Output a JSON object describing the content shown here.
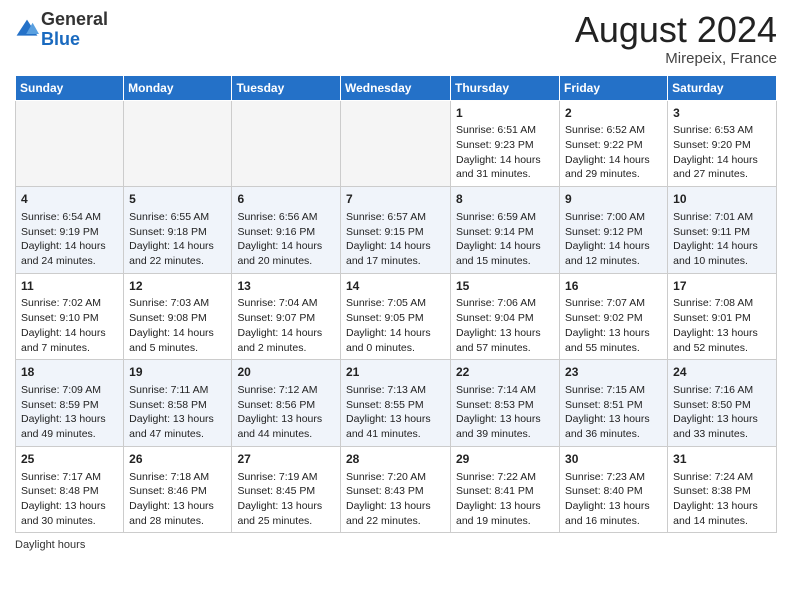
{
  "header": {
    "logo_general": "General",
    "logo_blue": "Blue",
    "month_year": "August 2024",
    "location": "Mirepeix, France"
  },
  "footer": {
    "daylight_label": "Daylight hours"
  },
  "days_of_week": [
    "Sunday",
    "Monday",
    "Tuesday",
    "Wednesday",
    "Thursday",
    "Friday",
    "Saturday"
  ],
  "weeks": [
    [
      {
        "day": "",
        "info": ""
      },
      {
        "day": "",
        "info": ""
      },
      {
        "day": "",
        "info": ""
      },
      {
        "day": "",
        "info": ""
      },
      {
        "day": "1",
        "info": "Sunrise: 6:51 AM\nSunset: 9:23 PM\nDaylight: 14 hours\nand 31 minutes."
      },
      {
        "day": "2",
        "info": "Sunrise: 6:52 AM\nSunset: 9:22 PM\nDaylight: 14 hours\nand 29 minutes."
      },
      {
        "day": "3",
        "info": "Sunrise: 6:53 AM\nSunset: 9:20 PM\nDaylight: 14 hours\nand 27 minutes."
      }
    ],
    [
      {
        "day": "4",
        "info": "Sunrise: 6:54 AM\nSunset: 9:19 PM\nDaylight: 14 hours\nand 24 minutes."
      },
      {
        "day": "5",
        "info": "Sunrise: 6:55 AM\nSunset: 9:18 PM\nDaylight: 14 hours\nand 22 minutes."
      },
      {
        "day": "6",
        "info": "Sunrise: 6:56 AM\nSunset: 9:16 PM\nDaylight: 14 hours\nand 20 minutes."
      },
      {
        "day": "7",
        "info": "Sunrise: 6:57 AM\nSunset: 9:15 PM\nDaylight: 14 hours\nand 17 minutes."
      },
      {
        "day": "8",
        "info": "Sunrise: 6:59 AM\nSunset: 9:14 PM\nDaylight: 14 hours\nand 15 minutes."
      },
      {
        "day": "9",
        "info": "Sunrise: 7:00 AM\nSunset: 9:12 PM\nDaylight: 14 hours\nand 12 minutes."
      },
      {
        "day": "10",
        "info": "Sunrise: 7:01 AM\nSunset: 9:11 PM\nDaylight: 14 hours\nand 10 minutes."
      }
    ],
    [
      {
        "day": "11",
        "info": "Sunrise: 7:02 AM\nSunset: 9:10 PM\nDaylight: 14 hours\nand 7 minutes."
      },
      {
        "day": "12",
        "info": "Sunrise: 7:03 AM\nSunset: 9:08 PM\nDaylight: 14 hours\nand 5 minutes."
      },
      {
        "day": "13",
        "info": "Sunrise: 7:04 AM\nSunset: 9:07 PM\nDaylight: 14 hours\nand 2 minutes."
      },
      {
        "day": "14",
        "info": "Sunrise: 7:05 AM\nSunset: 9:05 PM\nDaylight: 14 hours\nand 0 minutes."
      },
      {
        "day": "15",
        "info": "Sunrise: 7:06 AM\nSunset: 9:04 PM\nDaylight: 13 hours\nand 57 minutes."
      },
      {
        "day": "16",
        "info": "Sunrise: 7:07 AM\nSunset: 9:02 PM\nDaylight: 13 hours\nand 55 minutes."
      },
      {
        "day": "17",
        "info": "Sunrise: 7:08 AM\nSunset: 9:01 PM\nDaylight: 13 hours\nand 52 minutes."
      }
    ],
    [
      {
        "day": "18",
        "info": "Sunrise: 7:09 AM\nSunset: 8:59 PM\nDaylight: 13 hours\nand 49 minutes."
      },
      {
        "day": "19",
        "info": "Sunrise: 7:11 AM\nSunset: 8:58 PM\nDaylight: 13 hours\nand 47 minutes."
      },
      {
        "day": "20",
        "info": "Sunrise: 7:12 AM\nSunset: 8:56 PM\nDaylight: 13 hours\nand 44 minutes."
      },
      {
        "day": "21",
        "info": "Sunrise: 7:13 AM\nSunset: 8:55 PM\nDaylight: 13 hours\nand 41 minutes."
      },
      {
        "day": "22",
        "info": "Sunrise: 7:14 AM\nSunset: 8:53 PM\nDaylight: 13 hours\nand 39 minutes."
      },
      {
        "day": "23",
        "info": "Sunrise: 7:15 AM\nSunset: 8:51 PM\nDaylight: 13 hours\nand 36 minutes."
      },
      {
        "day": "24",
        "info": "Sunrise: 7:16 AM\nSunset: 8:50 PM\nDaylight: 13 hours\nand 33 minutes."
      }
    ],
    [
      {
        "day": "25",
        "info": "Sunrise: 7:17 AM\nSunset: 8:48 PM\nDaylight: 13 hours\nand 30 minutes."
      },
      {
        "day": "26",
        "info": "Sunrise: 7:18 AM\nSunset: 8:46 PM\nDaylight: 13 hours\nand 28 minutes."
      },
      {
        "day": "27",
        "info": "Sunrise: 7:19 AM\nSunset: 8:45 PM\nDaylight: 13 hours\nand 25 minutes."
      },
      {
        "day": "28",
        "info": "Sunrise: 7:20 AM\nSunset: 8:43 PM\nDaylight: 13 hours\nand 22 minutes."
      },
      {
        "day": "29",
        "info": "Sunrise: 7:22 AM\nSunset: 8:41 PM\nDaylight: 13 hours\nand 19 minutes."
      },
      {
        "day": "30",
        "info": "Sunrise: 7:23 AM\nSunset: 8:40 PM\nDaylight: 13 hours\nand 16 minutes."
      },
      {
        "day": "31",
        "info": "Sunrise: 7:24 AM\nSunset: 8:38 PM\nDaylight: 13 hours\nand 14 minutes."
      }
    ]
  ]
}
